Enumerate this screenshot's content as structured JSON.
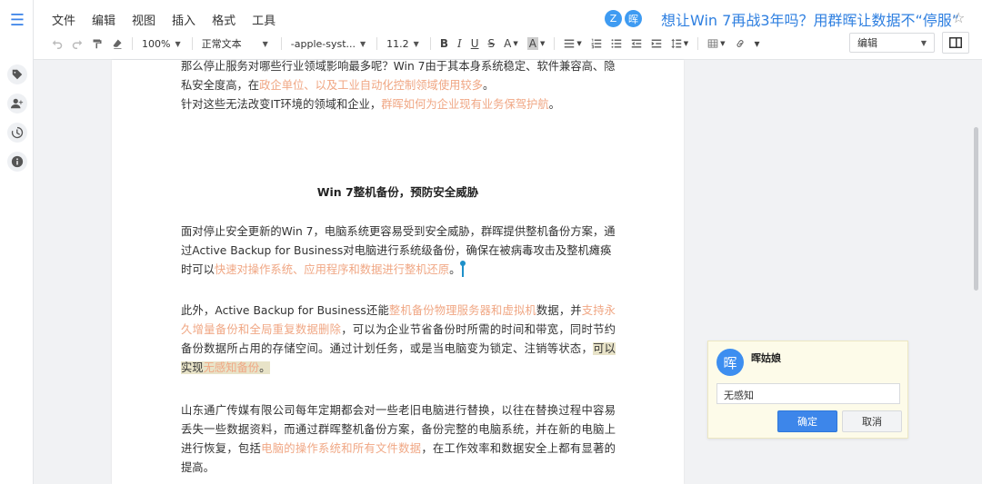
{
  "menubar": {
    "items": [
      "文件",
      "编辑",
      "视图",
      "插入",
      "格式",
      "工具"
    ]
  },
  "collaborators": [
    {
      "initial": "Z",
      "color": "#3e9bf2"
    },
    {
      "initial": "晖",
      "color": "#3e9bf2"
    }
  ],
  "document": {
    "title": "想让Win 7再战3年吗？用群晖让数据不“停服”"
  },
  "toolbar": {
    "zoom": "100%",
    "style": "正常文本",
    "font": "-apple-syst...",
    "size": "11.2",
    "mode": "编辑"
  },
  "content": {
    "p1": {
      "a": "那么停止服务对哪些行业领域影响最多呢？Win  7由于其本身系统稳定、软件兼容高、隐私安全度高，在",
      "b": "政企单位、以及工业自动化控制领域使用较多",
      "c": "。"
    },
    "p2": {
      "a": "针对这些无法改变IT环境的领域和企业，",
      "b": "群晖如何为企业现有业务保驾护航",
      "c": "。"
    },
    "heading": "Win 7整机备份，预防安全威胁",
    "p3": {
      "a": "面对停止安全更新的Win 7，电脑系统更容易受到安全威胁，群晖提供整机备份方案，通过Active Backup for Business对电脑进行系统级备份，确保在被病毒攻击及整机瘫痪时可以",
      "b": "快速对操作系统、应用程序和数据进行整机还原",
      "c": "。"
    },
    "p4": {
      "a": "此外，Active Backup for Business还能",
      "b": "整机备份物理服务器和虚拟机",
      "c": "数据，并",
      "d": "支持永久增量备份和全局重复数据删除",
      "e": "，可以为企业节省备份时所需的时间和带宽，同时节约备份数据所占用的存储空间。通过计划任务，或是当电脑变为锁定、注销等状态，",
      "f": "可以实现",
      "g": "无感知备份",
      "h": "。"
    },
    "p5": {
      "a": "山东通广传媒有限公司每年定期都会对一些老旧电脑进行替换，以往在替换过程中容易丢失一些数据资料，而通过群晖整机备份方案，备份完整的电脑系统，并在新的电脑上进行恢复，包括",
      "b": "电脑的操作系统和所有文件数据",
      "c": "，在工作效率和数据安全上都有显著的提高。"
    }
  },
  "comment": {
    "avatar": "晖",
    "author": "晖姑娘",
    "value": "无感知",
    "ok": "确定",
    "cancel": "取消"
  },
  "colors": {
    "accent": "#3d86ea",
    "highlight": "#f0a784"
  }
}
